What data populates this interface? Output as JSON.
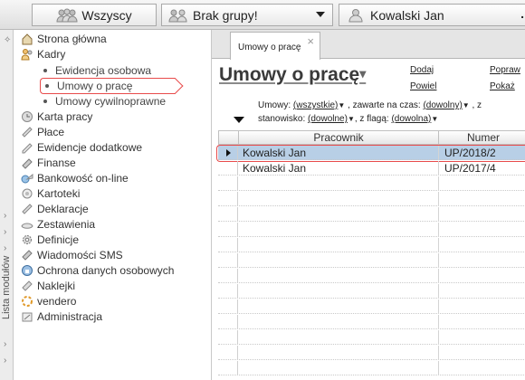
{
  "topbar": {
    "group_combo": "Wszyscy",
    "nogroup_combo": "Brak grupy!",
    "person_combo": "Kowalski Jan",
    "person_more": "."
  },
  "sidebar": {
    "vertical_label": "Lista modułów",
    "items": [
      {
        "label": "Strona główna",
        "icon": "home-icon"
      },
      {
        "label": "Kadry",
        "icon": "people-icon"
      },
      {
        "label": "Ewidencja osobowa",
        "sub": true
      },
      {
        "label": "Umowy o pracę",
        "sub": true,
        "active": true
      },
      {
        "label": "Umowy cywilnoprawne",
        "sub": true
      },
      {
        "label": "Karta pracy",
        "icon": "card-icon"
      },
      {
        "label": "Płace",
        "icon": "wallet-icon"
      },
      {
        "label": "Ewidencje dodatkowe",
        "icon": "records-icon"
      },
      {
        "label": "Finanse",
        "icon": "finance-icon"
      },
      {
        "label": "Bankowość on-line",
        "icon": "bank-icon"
      },
      {
        "label": "Kartoteki",
        "icon": "catalog-icon"
      },
      {
        "label": "Deklaracje",
        "icon": "declaration-icon"
      },
      {
        "label": "Zestawienia",
        "icon": "report-icon"
      },
      {
        "label": "Definicje",
        "icon": "gear-icon"
      },
      {
        "label": "Wiadomości SMS",
        "icon": "sms-icon"
      },
      {
        "label": "Ochrona danych osobowych",
        "icon": "shield-icon"
      },
      {
        "label": "Naklejki",
        "icon": "sticker-icon"
      },
      {
        "label": "vendero",
        "icon": "vendero-icon"
      },
      {
        "label": "Administracja",
        "icon": "admin-icon"
      }
    ]
  },
  "main": {
    "tab_label": "Umowy o pracę",
    "page_title": "Umowy o pracę",
    "actions": {
      "dodaj": "Dodaj",
      "popraw": "Popraw",
      "powiel": "Powiel",
      "pokaz": "Pokaż"
    },
    "filters": {
      "umowy_label": "Umowy:",
      "umowy_value": "(wszystkie)",
      "zawarte_label": ", zawarte na czas:",
      "zawarte_value": "(dowolny)",
      "zawarte_tail": ", z",
      "stanowisko_label": "stanowisko:",
      "stanowisko_value": "(dowolne)",
      "flaga_label": ", z flagą:",
      "flaga_value": "(dowolna)"
    },
    "grid": {
      "columns": [
        "Pracownik",
        "Numer"
      ],
      "rows": [
        {
          "pracownik": "Kowalski Jan",
          "numer": "UP/2018/2",
          "selected": true
        },
        {
          "pracownik": "Kowalski Jan",
          "numer": "UP/2017/4",
          "selected": false
        }
      ]
    }
  },
  "colors": {
    "selection": "#b8cfe6",
    "highlight": "#e84b4b"
  }
}
